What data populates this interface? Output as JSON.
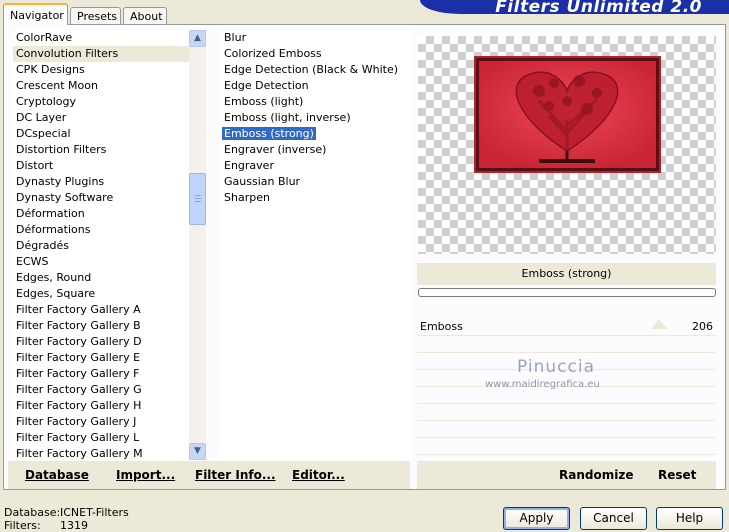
{
  "tabs": [
    "Navigator",
    "Presets",
    "About"
  ],
  "banner": "Filters Unlimited 2.0",
  "categories": [
    "ColorRave",
    "Convolution Filters",
    "CPK Designs",
    "Crescent Moon",
    "Cryptology",
    "DC Layer",
    "DCspecial",
    "Distortion Filters",
    "Distort",
    "Dynasty Plugins",
    "Dynasty Software",
    "Déformation",
    "Déformations",
    "Dégradés",
    "ECWS",
    "Edges, Round",
    "Edges, Square",
    "Filter Factory Gallery A",
    "Filter Factory Gallery B",
    "Filter Factory Gallery D",
    "Filter Factory Gallery E",
    "Filter Factory Gallery F",
    "Filter Factory Gallery G",
    "Filter Factory Gallery H",
    "Filter Factory Gallery J",
    "Filter Factory Gallery L",
    "Filter Factory Gallery M"
  ],
  "selected_category": "Convolution Filters",
  "filters": [
    "Blur",
    "Colorized Emboss",
    "Edge Detection (Black & White)",
    "Edge Detection",
    "Emboss (light)",
    "Emboss (light, inverse)",
    "Emboss (strong)",
    "Engraver (inverse)",
    "Engraver",
    "Gaussian Blur",
    "Sharpen"
  ],
  "selected_filter": "Emboss (strong)",
  "preview_filter_name": "Emboss (strong)",
  "param": {
    "label": "Emboss",
    "value": "206"
  },
  "watermark": {
    "name": "Pinuccia",
    "url": "www.maidiregrafica.eu"
  },
  "left_buttons": {
    "database": "Database",
    "import": "Import...",
    "filter_info": "Filter Info...",
    "editor": "Editor..."
  },
  "right_buttons": {
    "randomize": "Randomize",
    "reset": "Reset"
  },
  "status": {
    "database_label": "Database:",
    "database_value": "ICNET-Filters",
    "filters_label": "Filters:",
    "filters_value": "1319"
  },
  "dialog_buttons": {
    "apply": "Apply",
    "cancel": "Cancel",
    "help": "Help"
  }
}
